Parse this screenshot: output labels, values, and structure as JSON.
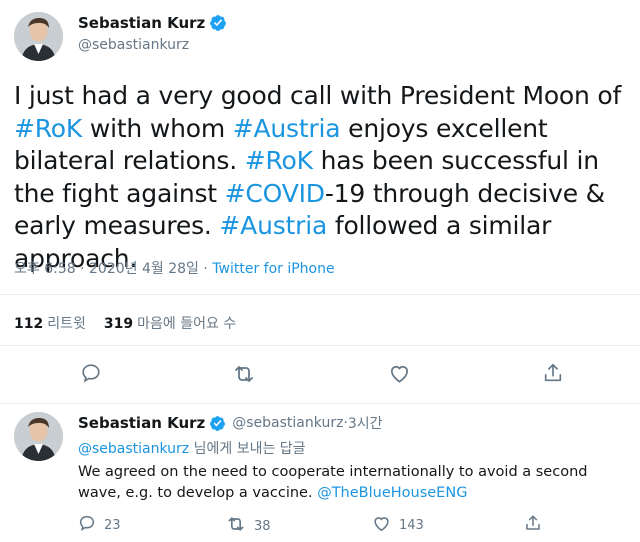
{
  "main_tweet": {
    "author": {
      "display_name": "Sebastian Kurz",
      "handle": "@sebastiankurz",
      "verified": true,
      "avatar_icon": "avatar-photo"
    },
    "text": {
      "p1": "I just had a very good call with President Moon of ",
      "tag1": "#RoK",
      "p2": " with whom ",
      "tag2": "#Austria",
      "p3": " enjoys excellent bilateral relations. ",
      "tag3": "#RoK",
      "p4": " has been successful in the fight against ",
      "tag4": "#COVID",
      "p5": "-19 through decisive & early measures. ",
      "tag5": "#Austria",
      "p6": " followed a similar approach."
    },
    "meta": {
      "time": "오후 6:58",
      "sep1": " · ",
      "date": "2020년 4월 28일",
      "sep2": " · ",
      "source": "Twitter for iPhone"
    },
    "stats": {
      "retweets_count": "112",
      "retweets_label": "리트윗",
      "likes_count": "319",
      "likes_label": "마음에 들어요 수"
    },
    "actions": [
      "reply-icon",
      "retweet-icon",
      "like-icon",
      "share-icon"
    ]
  },
  "reply_tweet": {
    "author": {
      "display_name": "Sebastian Kurz",
      "handle": "@sebastiankurz",
      "time_sep": " · ",
      "time": "3시간",
      "verified": true
    },
    "replying_to": {
      "mention": "@sebastiankurz",
      "suffix": " 님에게 보내는 답글"
    },
    "text": {
      "body": "We agreed on the need to cooperate internationally to avoid a second wave, e.g. to develop a vaccine. ",
      "mention": "@TheBlueHouseENG"
    },
    "actions": {
      "reply_count": "23",
      "retweet_count": "38",
      "like_count": "143"
    }
  },
  "colors": {
    "accent": "#1b95e0",
    "text": "#14171a",
    "secondary": "#657786",
    "divider": "#e6ecf0",
    "verified": "#1da1f2"
  }
}
